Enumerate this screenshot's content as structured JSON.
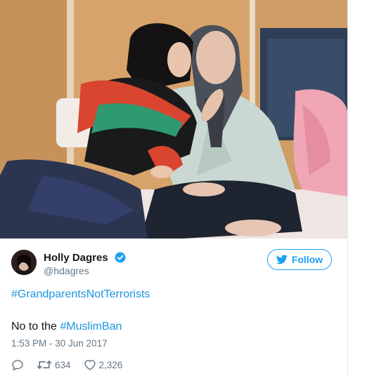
{
  "tweet": {
    "user": {
      "name": "Holly Dagres",
      "handle": "@hdagres"
    },
    "follow_label": "Follow",
    "hashtag_line": "#GrandparentsNotTerrorists",
    "text_prefix": "No to the ",
    "text_hashtag": "#MuslimBan",
    "timestamp": "1:53 PM - 30 Jun 2017",
    "retweet_count": "634",
    "like_count": "2,326"
  },
  "icons": {
    "verified": "verified-badge-icon",
    "follow": "twitter-bird-icon",
    "reply": "reply-icon",
    "retweet": "retweet-icon",
    "like": "heart-icon"
  },
  "colors": {
    "link": "#1b95e0",
    "accent": "#1da1f2",
    "muted": "#657786"
  }
}
